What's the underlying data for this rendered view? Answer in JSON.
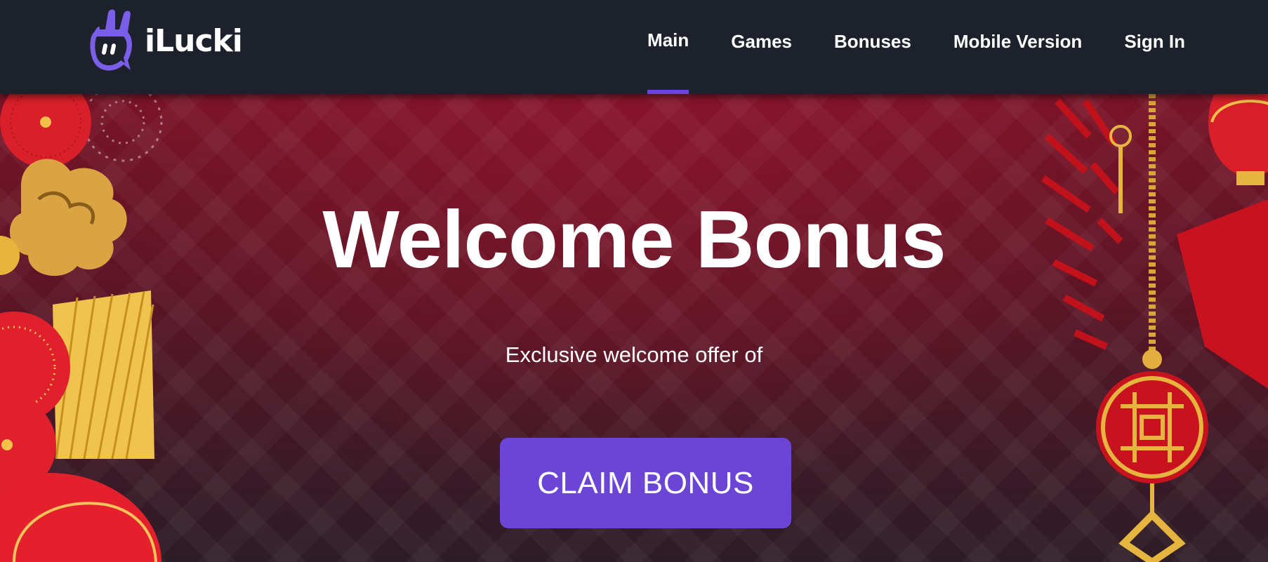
{
  "brand": {
    "name": "iLucki"
  },
  "nav": {
    "items": [
      {
        "label": "Main",
        "active": true
      },
      {
        "label": "Games",
        "active": false
      },
      {
        "label": "Bonuses",
        "active": false
      },
      {
        "label": "Mobile Version",
        "active": false
      },
      {
        "label": "Sign In",
        "active": false
      }
    ]
  },
  "hero": {
    "title": "Welcome Bonus",
    "subtitle": "Exclusive welcome offer of",
    "cta_label": "CLAIM BONUS"
  },
  "colors": {
    "header_bg": "#1c212c",
    "accent": "#6b46d6",
    "hero_red": "#7a1428",
    "text": "#ffffff"
  },
  "icons": {
    "logo": "rabbit-hand-logo-icon"
  }
}
